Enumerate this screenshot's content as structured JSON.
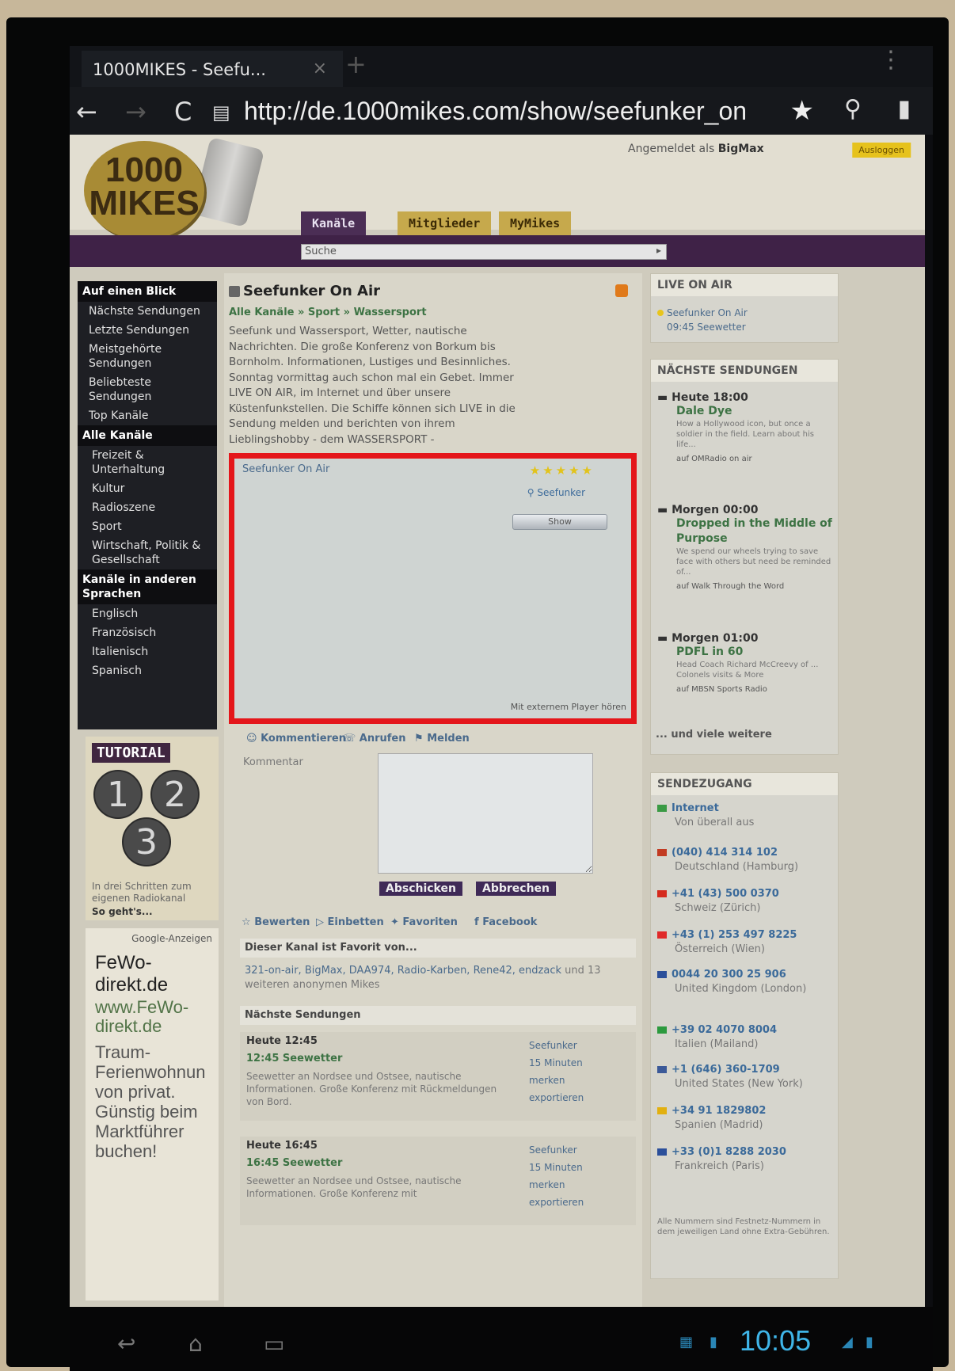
{
  "browser": {
    "tab_title": "1000MIKES - Seefu...",
    "tab_close": "×",
    "new_tab": "+",
    "url": "http://de.1000mikes.com/show/seefunker_on",
    "back_icon": "←",
    "forward_icon": "→",
    "reload_icon": "C",
    "menu_icon": "⋮"
  },
  "header": {
    "logo_line1": "1000",
    "logo_line2": "MIKES",
    "logged_in_label": "Angemeldet als",
    "username": "BigMax",
    "logout": "Ausloggen",
    "tabs": [
      "Kanäle",
      "Mitglieder",
      "MyMikes"
    ],
    "search_value": "Suche"
  },
  "sidebar": {
    "sections": [
      {
        "label": "Auf einen Blick",
        "items": [
          "Nächste Sendungen",
          "Letzte Sendungen",
          "Meistgehörte Sendungen",
          "Beliebteste Sendungen",
          "Top Kanäle"
        ]
      },
      {
        "label": "Alle Kanäle",
        "items": [
          "Freizeit & Unterhaltung",
          "Kultur",
          "Radioszene",
          "Sport",
          "Wirtschaft, Politik & Gesellschaft"
        ]
      },
      {
        "label": "Kanäle in anderen Sprachen",
        "items": [
          "Englisch",
          "Französisch",
          "Italienisch",
          "Spanisch"
        ]
      }
    ],
    "tutorial": {
      "title": "TUTORIAL",
      "numbers": [
        "1",
        "2",
        "3"
      ],
      "text": "In drei Schritten zum eigenen Radiokanal",
      "link": "So geht's..."
    },
    "ad": {
      "google": "Google-Anzeigen",
      "title": "FeWo-direkt.de",
      "url": "www.FeWo-direkt.de",
      "desc": "Traum-Ferienwohnun von privat. Günstig beim Marktführer buchen!"
    }
  },
  "show": {
    "title": "Seefunker On Air",
    "breadcrumb": "Alle Kanäle » Sport » Wassersport",
    "description": "Seefunk und Wassersport, Wetter, nautische Nachrichten. Die große Konferenz von Borkum bis Bornholm. Informationen, Lustiges und Besinnliches. Sonntag vormittag auch schon mal ein Gebet. Immer LIVE ON AIR, im Internet und über unsere Küstenfunkstellen. Die Schiffe können sich LIVE in die Sendung melden und berichten von ihrem Lieblingshobby - dem WASSERSPORT -",
    "player": {
      "title": "Seefunker On Air",
      "stars": "★★★★★",
      "user": "Seefunker",
      "button": "Show",
      "external": "Mit externem Player hören"
    },
    "actions": [
      "Kommentieren",
      "Anrufen",
      "Melden"
    ],
    "comment_label": "Kommentar",
    "submit": "Abschicken",
    "cancel": "Abbrechen",
    "actions2": [
      "Bewerten",
      "Einbetten",
      "Favoriten",
      "Facebook"
    ],
    "fav_head": "Dieser Kanal ist Favorit von...",
    "fav_names": "321-on-air, BigMax, DAA974, Radio-Karben, Rene42, endzack",
    "fav_tail": "und 13 weiteren anonymen Mikes",
    "next_head": "Nächste Sendungen",
    "episodes": [
      {
        "when": "Heute 12:45",
        "title": "12:45 Seewetter",
        "desc": "Seewetter an Nordsee und Ostsee, nautische Informationen. Große Konferenz mit Rückmeldungen von Bord.",
        "user": "Seefunker",
        "duration": "15 Minuten",
        "remind": "merken",
        "export": "exportieren"
      },
      {
        "when": "Heute 16:45",
        "title": "16:45 Seewetter",
        "desc": "Seewetter an Nordsee und Ostsee, nautische Informationen. Große Konferenz mit",
        "user": "Seefunker",
        "duration": "15 Minuten",
        "remind": "merken",
        "export": "exportieren"
      }
    ]
  },
  "right": {
    "live": {
      "head": "LIVE ON AIR",
      "channel": "Seefunker On Air",
      "show": "09:45 Seewetter"
    },
    "next": {
      "head": "NÄCHSTE SENDUNGEN",
      "items": [
        {
          "when": "Heute 18:00",
          "title": "Dale Dye",
          "desc": "How a Hollywood icon, but once a soldier in the field. Learn about his life...",
          "src": "auf OMRadio on air"
        },
        {
          "when": "Morgen 00:00",
          "title": "Dropped in the Middle of Purpose",
          "desc": "We spend our wheels trying to save face with others but need be reminded of...",
          "src": "auf Walk Through the Word"
        },
        {
          "when": "Morgen 01:00",
          "title": "PDFL in 60",
          "desc": "Head Coach Richard McCreevy of ... Colonels visits & More",
          "src": "auf MBSN Sports Radio"
        }
      ],
      "more": "... und viele weitere"
    },
    "access": {
      "head": "SENDEZUGANG",
      "items": [
        {
          "n": "Internet",
          "p": "Von überall aus",
          "color": "#3a9a44"
        },
        {
          "n": "(040) 414 314 102",
          "p": "Deutschland (Hamburg)",
          "color": "#c23b22"
        },
        {
          "n": "+41 (43) 500 0370",
          "p": "Schweiz (Zürich)",
          "color": "#d52b1e"
        },
        {
          "n": "+43 (1) 253 497 8225",
          "p": "Österreich (Wien)",
          "color": "#e02a2a"
        },
        {
          "n": "0044 20 300 25 906",
          "p": "United Kingdom (London)",
          "color": "#2b4f9a"
        },
        {
          "n": "+39 02 4070 8004",
          "p": "Italien (Mailand)",
          "color": "#2c9a3e"
        },
        {
          "n": "+1 (646) 360-1709",
          "p": "United States (New York)",
          "color": "#3b5998"
        },
        {
          "n": "+34 91 1829802",
          "p": "Spanien (Madrid)",
          "color": "#e2b010"
        },
        {
          "n": "+33 (0)1 8288 2030",
          "p": "Frankreich (Paris)",
          "color": "#2b4f9a"
        }
      ],
      "footer": "Alle Nummern sind Festnetz-Nummern in dem jeweiligen Land ohne Extra-Gebühren."
    }
  },
  "system": {
    "time": "10:05"
  }
}
